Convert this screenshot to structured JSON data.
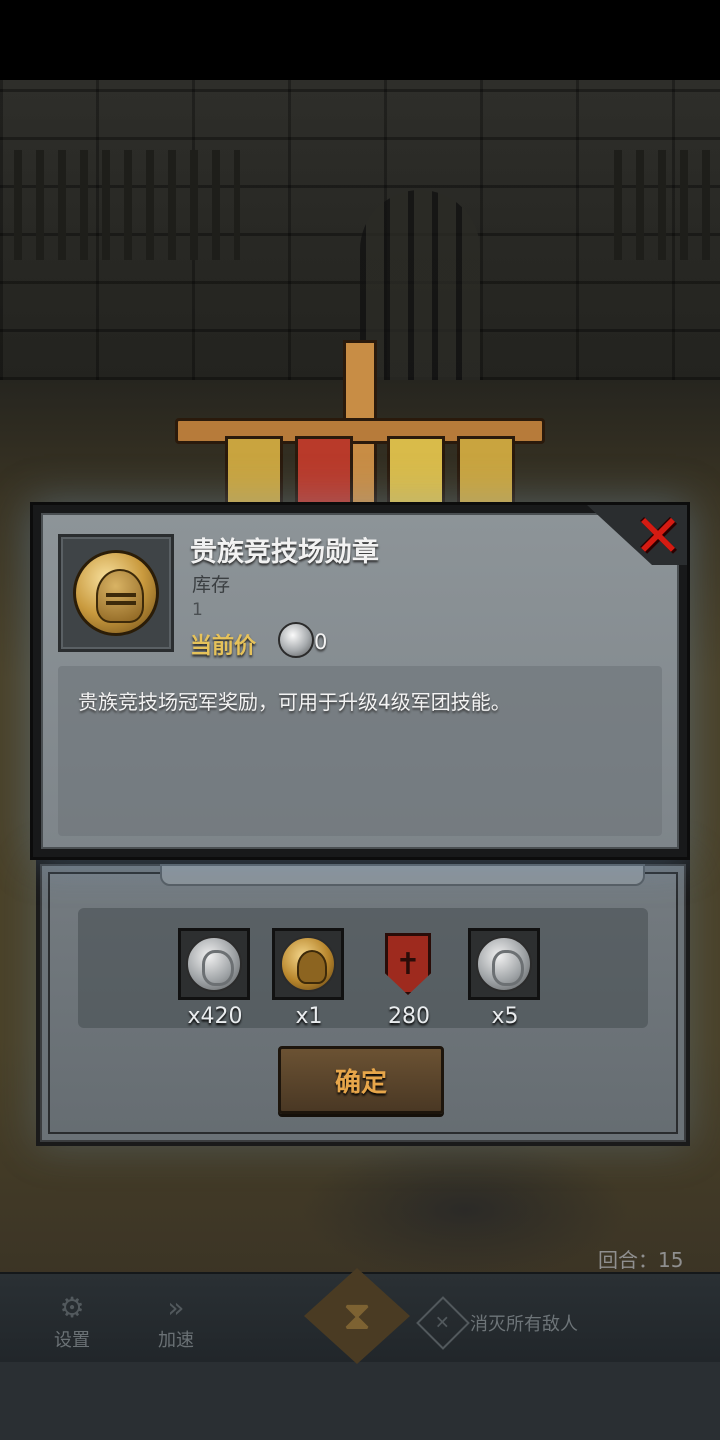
{
  "item": {
    "title": "贵族竞技场勋章",
    "stock_label": "库存",
    "stock_value": "1",
    "price_label": "当前价",
    "price_value": "0",
    "description": "贵族竞技场冠军奖励，可用于升级4级军团技能。"
  },
  "rewards": [
    {
      "icon": "silver-coin-icon",
      "count": "x420"
    },
    {
      "icon": "arena-medal-icon",
      "count": "x1"
    },
    {
      "icon": "legion-shield-icon",
      "count": "280"
    },
    {
      "icon": "silver-coin-icon",
      "count": "x5"
    }
  ],
  "confirm_label": "确定",
  "close_glyph": "✕",
  "round_label": "回合：15",
  "hud": {
    "settings_label": "设置",
    "speed_label": "加速",
    "objective_label": "消灭所有敌人"
  },
  "colors": {
    "title_gold": "#e6c25a",
    "close_red": "#d51b12",
    "confirm_text": "#e7a64a"
  }
}
